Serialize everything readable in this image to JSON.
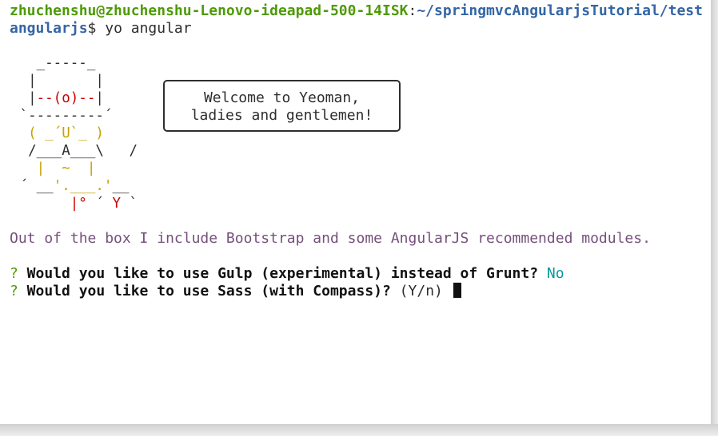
{
  "prompt": {
    "user_host": "zhuchenshu@zhuchenshu-Lenovo-ideapad-500-14ISK",
    "separator": ":",
    "path_line1": "~/springmvcAngularjsTutorial/test",
    "path_line2": "angularjs",
    "symbol": "$",
    "command": " yo angular"
  },
  "yeoman_art": {
    "line1": "   _-----_",
    "line2_a": "  |       |",
    "line3_a": "  |",
    "line3_b": "--(o)--",
    "line3_c": "|",
    "line4": " `---------´",
    "line5": "  ( _´U`_ )",
    "line6": "  /___A___\\   /",
    "line7": "   |  ~  |",
    "line8_a": " ´ ",
    "line8_b": "__",
    "line8_c": "'.___.'",
    "line8_d": "__",
    "line9_a": "     ",
    "line9_b": "  |°",
    "line9_c": " ´ ",
    "line9_d": "Y",
    "line9_e": " `"
  },
  "speech_bubble": {
    "line1": "Welcome to Yeoman,",
    "line2": "ladies and gentlemen!"
  },
  "info_message": "Out of the box I include Bootstrap and some AngularJS recommended modules.",
  "questions": [
    {
      "mark": "?",
      "text": " Would you like to use Gulp (experimental) instead of Grunt?",
      "answer": " No"
    },
    {
      "mark": "?",
      "text": " Would you like to use Sass (with Compass)?",
      "answer": " (Y/n) "
    }
  ],
  "colors": {
    "prompt_user": "#4e9a06",
    "prompt_path": "#3465a4",
    "info": "#75507b",
    "answer": "#06989a",
    "art_red": "#cc0000",
    "art_yellow": "#c4a000"
  }
}
